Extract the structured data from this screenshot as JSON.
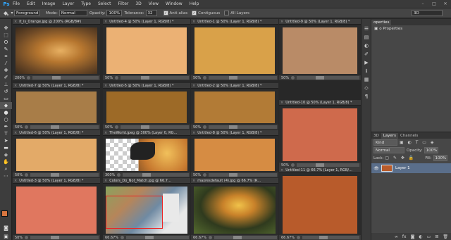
{
  "app": {
    "logo": "Ps",
    "menu": [
      "File",
      "Edit",
      "Image",
      "Layer",
      "Type",
      "Select",
      "Filter",
      "3D",
      "View",
      "Window",
      "Help"
    ],
    "window_controls": [
      "–",
      "□",
      "✕"
    ],
    "workspace": "3D"
  },
  "options": {
    "tool_icon": "paint-bucket-icon",
    "fill_source": "Foreground",
    "mode_label": "Mode:",
    "mode_value": "Normal",
    "opacity_label": "Opacity:",
    "opacity_value": "100%",
    "tolerance_label": "Tolerance:",
    "tolerance_value": "32",
    "antialias_label": "Anti-alias",
    "contiguous_label": "Contiguous",
    "all_layers_label": "All Layers"
  },
  "documents": [
    {
      "title": "it_is_Orange.jpg @ 200% (RGB/8#)",
      "zoom": "200%",
      "color": "#c8924a",
      "kind": "photo-orange"
    },
    {
      "title": "Untitled-4 @ 50% (Layer 1, RGB/8) *",
      "zoom": "50%",
      "color": "#ebb174"
    },
    {
      "title": "Untitled-1 @ 50% (Layer 1, RGB/8) *",
      "zoom": "50%",
      "color": "#d9a149"
    },
    {
      "title": "Untitled-9 @ 50% (Layer 1, RGB/8) *",
      "zoom": "50%",
      "color": "#b98b67"
    },
    {
      "title": "Untitled-7 @ 50% (Layer 1, RGB/8) *",
      "zoom": "50%",
      "color": "#a87d48"
    },
    {
      "title": "Untitled-5 @ 50% (Layer 1, RGB/8) *",
      "zoom": "50%",
      "color": "#9d6a27"
    },
    {
      "title": "Untitled-2 @ 50% (Layer 1, RGB/8) *",
      "zoom": "50%",
      "color": "#b27b36"
    },
    {
      "title": "Untitled-10 @ 50% (Layer 1, RGB/8) *",
      "zoom": "50%",
      "color": "#cf6a4c"
    },
    {
      "title": "Untitled-6 @ 50% (Layer 1, RGB/8) *",
      "zoom": "50%",
      "color": "#e3aa68"
    },
    {
      "title": "TheWorld.jpeg @ 300% (Layer 0, RG...",
      "zoom": "300%",
      "color": "#d88c3c",
      "kind": "photo-world"
    },
    {
      "title": "Untitled-8 @ 50% (Layer 1, RGB/8) *",
      "zoom": "50%",
      "color": "#d68c43"
    },
    {
      "title": "Untitled-11 @ 66.7% (Layer 1, RGB/...",
      "zoom": "66.67%",
      "color": "#b85b2b"
    },
    {
      "title": "Untitled-3 @ 50% (Layer 1, RGB/8) *",
      "zoom": "50%",
      "color": "#e0775f"
    },
    {
      "title": "Colors_Do_Not_Match.jpg @ 66.7...",
      "zoom": "66.67%",
      "color": "#6f8aa3",
      "kind": "photo-match"
    },
    {
      "title": "maxresdefault (4).jpg @ 66.7% (R...",
      "zoom": "66.67%",
      "color": "#4e5a2e",
      "kind": "photo-max"
    }
  ],
  "swatches": {
    "foreground": "#d8763f",
    "background": "#ffffff"
  },
  "properties_panel": {
    "tab": "operties",
    "title": "o Properties"
  },
  "layers_panel": {
    "tabs": [
      "3D",
      "Layers",
      "Channels"
    ],
    "filter": "Kind",
    "blend_mode": "Normal",
    "opacity_label": "Opacity:",
    "opacity_value": "100%",
    "lock_label": "Lock:",
    "fill_label": "Fill:",
    "fill_value": "100%",
    "layers": [
      {
        "name": "Layer 1",
        "color": "#b85b2b"
      }
    ]
  }
}
